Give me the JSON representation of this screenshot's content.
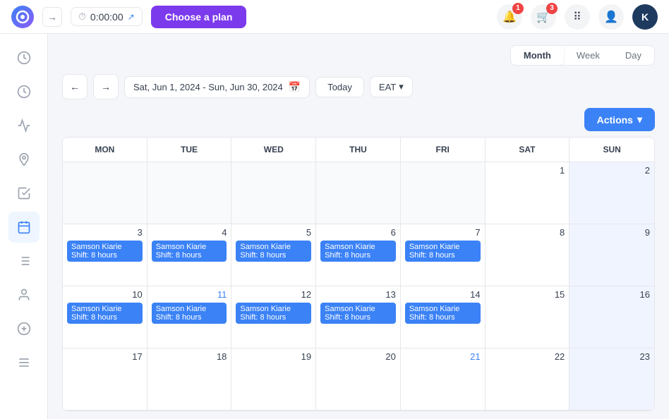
{
  "header": {
    "timer": "0:00:00",
    "choose_plan": "Choose a plan",
    "notifications_badge": "1",
    "cart_badge": "3",
    "avatar_initials": "K"
  },
  "sidebar": {
    "items": [
      {
        "name": "history-icon",
        "icon": "🕐"
      },
      {
        "name": "clock-icon",
        "icon": "⏰"
      },
      {
        "name": "chart-icon",
        "icon": "📈"
      },
      {
        "name": "location-icon",
        "icon": "📍"
      },
      {
        "name": "task-icon",
        "icon": "☑"
      },
      {
        "name": "calendar-icon",
        "icon": "📅"
      },
      {
        "name": "list-icon",
        "icon": "📋"
      },
      {
        "name": "person-icon",
        "icon": "👤"
      },
      {
        "name": "dollar-icon",
        "icon": "💲"
      },
      {
        "name": "settings-icon",
        "icon": "⚙"
      }
    ]
  },
  "view_toggle": {
    "options": [
      "Month",
      "Week",
      "Day"
    ],
    "active": "Month"
  },
  "calendar_nav": {
    "date_range": "Sat, Jun 1, 2024 - Sun, Jun 30, 2024",
    "today_label": "Today",
    "timezone": "EAT",
    "actions_label": "Actions"
  },
  "calendar": {
    "days": [
      "MON",
      "TUE",
      "WED",
      "THU",
      "FRI",
      "SAT",
      "SUN"
    ],
    "weeks": [
      {
        "cells": [
          {
            "day": "",
            "empty": true
          },
          {
            "day": "",
            "empty": true
          },
          {
            "day": "",
            "empty": true
          },
          {
            "day": "",
            "empty": true
          },
          {
            "day": "",
            "empty": true
          },
          {
            "day": "1",
            "weekend": false,
            "events": []
          },
          {
            "day": "2",
            "weekend": true,
            "events": []
          }
        ]
      },
      {
        "cells": [
          {
            "day": "3",
            "weekend": false,
            "events": [
              "Samson Kiarie\nShift: 8 hours"
            ]
          },
          {
            "day": "4",
            "weekend": false,
            "events": [
              "Samson Kiarie\nShift: 8 hours"
            ]
          },
          {
            "day": "5",
            "weekend": false,
            "events": [
              "Samson Kiarie\nShift: 8 hours"
            ]
          },
          {
            "day": "6",
            "weekend": false,
            "events": [
              "Samson Kiarie\nShift: 8 hours"
            ]
          },
          {
            "day": "7",
            "weekend": false,
            "events": [
              "Samson Kiarie\nShift: 8 hours"
            ]
          },
          {
            "day": "8",
            "weekend": false,
            "events": []
          },
          {
            "day": "9",
            "weekend": true,
            "events": []
          }
        ]
      },
      {
        "cells": [
          {
            "day": "10",
            "weekend": false,
            "events": [
              "Samson Kiarie\nShift: 8 hours"
            ]
          },
          {
            "day": "11",
            "weekend": false,
            "events": [
              "Samson Kiarie\nShift: 8 hours"
            ],
            "blue": true
          },
          {
            "day": "12",
            "weekend": false,
            "events": [
              "Samson Kiarie\nShift: 8 hours"
            ]
          },
          {
            "day": "13",
            "weekend": false,
            "events": [
              "Samson Kiarie\nShift: 8 hours"
            ]
          },
          {
            "day": "14",
            "weekend": false,
            "events": [
              "Samson Kiarie\nShift: 8 hours"
            ]
          },
          {
            "day": "15",
            "weekend": false,
            "events": []
          },
          {
            "day": "16",
            "weekend": true,
            "events": []
          }
        ]
      },
      {
        "cells": [
          {
            "day": "17",
            "weekend": false,
            "events": []
          },
          {
            "day": "18",
            "weekend": false,
            "events": []
          },
          {
            "day": "19",
            "weekend": false,
            "events": []
          },
          {
            "day": "20",
            "weekend": false,
            "events": []
          },
          {
            "day": "21",
            "weekend": false,
            "events": [],
            "blue": true
          },
          {
            "day": "22",
            "weekend": false,
            "events": []
          },
          {
            "day": "23",
            "weekend": true,
            "events": []
          }
        ]
      }
    ],
    "event_label": "Samson Kiarie",
    "event_sublabel": "Shift: 8 hours"
  }
}
